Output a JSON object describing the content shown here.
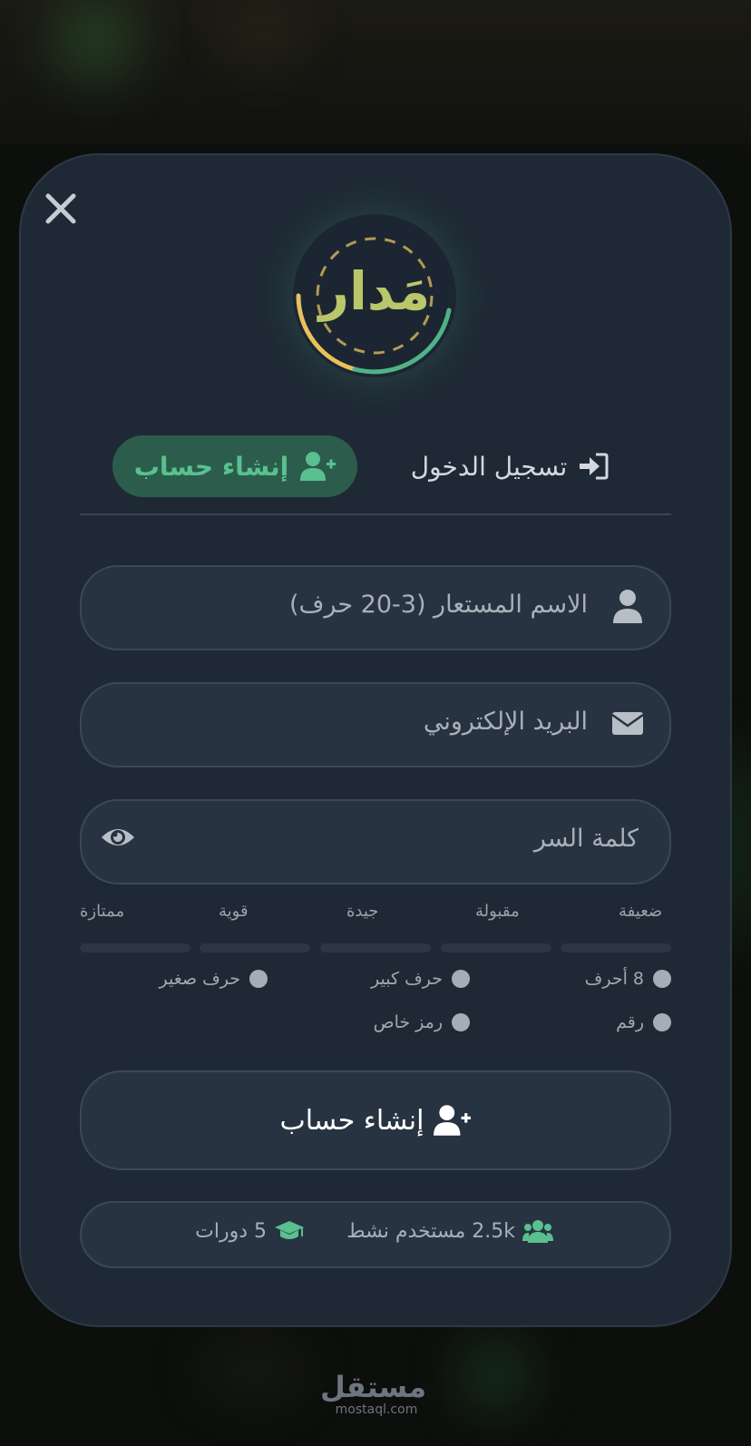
{
  "logo": {
    "text": "مَدار"
  },
  "tabs": {
    "register": {
      "label": "إنشاء حساب",
      "icon": "user-plus-icon"
    },
    "login": {
      "label": "تسجيل الدخول",
      "icon": "sign-in-icon"
    }
  },
  "form": {
    "username": {
      "placeholder": "الاسم المستعار (3-20 حرف)",
      "icon": "user-icon"
    },
    "email": {
      "placeholder": "البريد الإلكتروني",
      "icon": "envelope-icon"
    },
    "password": {
      "placeholder": "كلمة السر",
      "icon": "eye-icon"
    }
  },
  "strength": {
    "labels": [
      "ضعيفة",
      "مقبولة",
      "جيدة",
      "قوية",
      "ممتازة"
    ],
    "level": 0
  },
  "requirements": [
    "8 أحرف",
    "حرف كبير",
    "حرف صغير",
    "رقم",
    "رمز خاص"
  ],
  "submit": {
    "label": "إنشاء حساب",
    "icon": "user-plus-icon"
  },
  "stats": {
    "users": {
      "text": "2.5k مستخدم نشط",
      "icon": "users-icon"
    },
    "courses": {
      "text": "5 دورات",
      "icon": "graduation-cap-icon"
    }
  },
  "brand": {
    "arabic": "مستقل",
    "url": "mostaql.com"
  },
  "colors": {
    "accent": "#59c08f",
    "card": "#1f2935",
    "logo_gold": "#e8c15a"
  }
}
